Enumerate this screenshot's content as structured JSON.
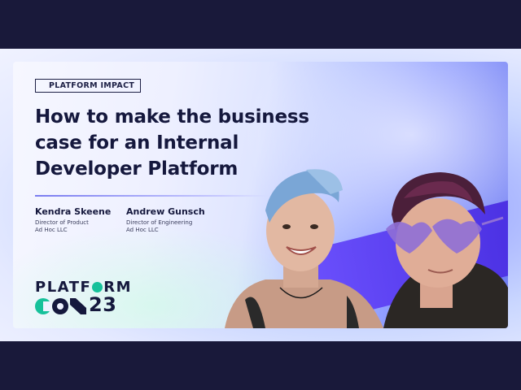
{
  "badge": "PLATFORM IMPACT",
  "title_lines": [
    "How to make the business",
    "case for an Internal",
    "Developer Platform"
  ],
  "speakers": [
    {
      "name": "Kendra Skeene",
      "role": "Director of Product",
      "org": "Ad Hoc LLC"
    },
    {
      "name": "Andrew Gunsch",
      "role": "Director of Engineering",
      "org": "Ad Hoc LLC"
    }
  ],
  "logo": {
    "word_before": "PLATF",
    "word_after": "RM",
    "number": "23"
  },
  "colors": {
    "accent_green": "#16c19a",
    "accent_navy": "#15183d",
    "accent_violet": "#5b3df5"
  },
  "photo": {
    "subjects": [
      "woman-with-blue-hair",
      "person-with-heart-sunglasses"
    ]
  }
}
